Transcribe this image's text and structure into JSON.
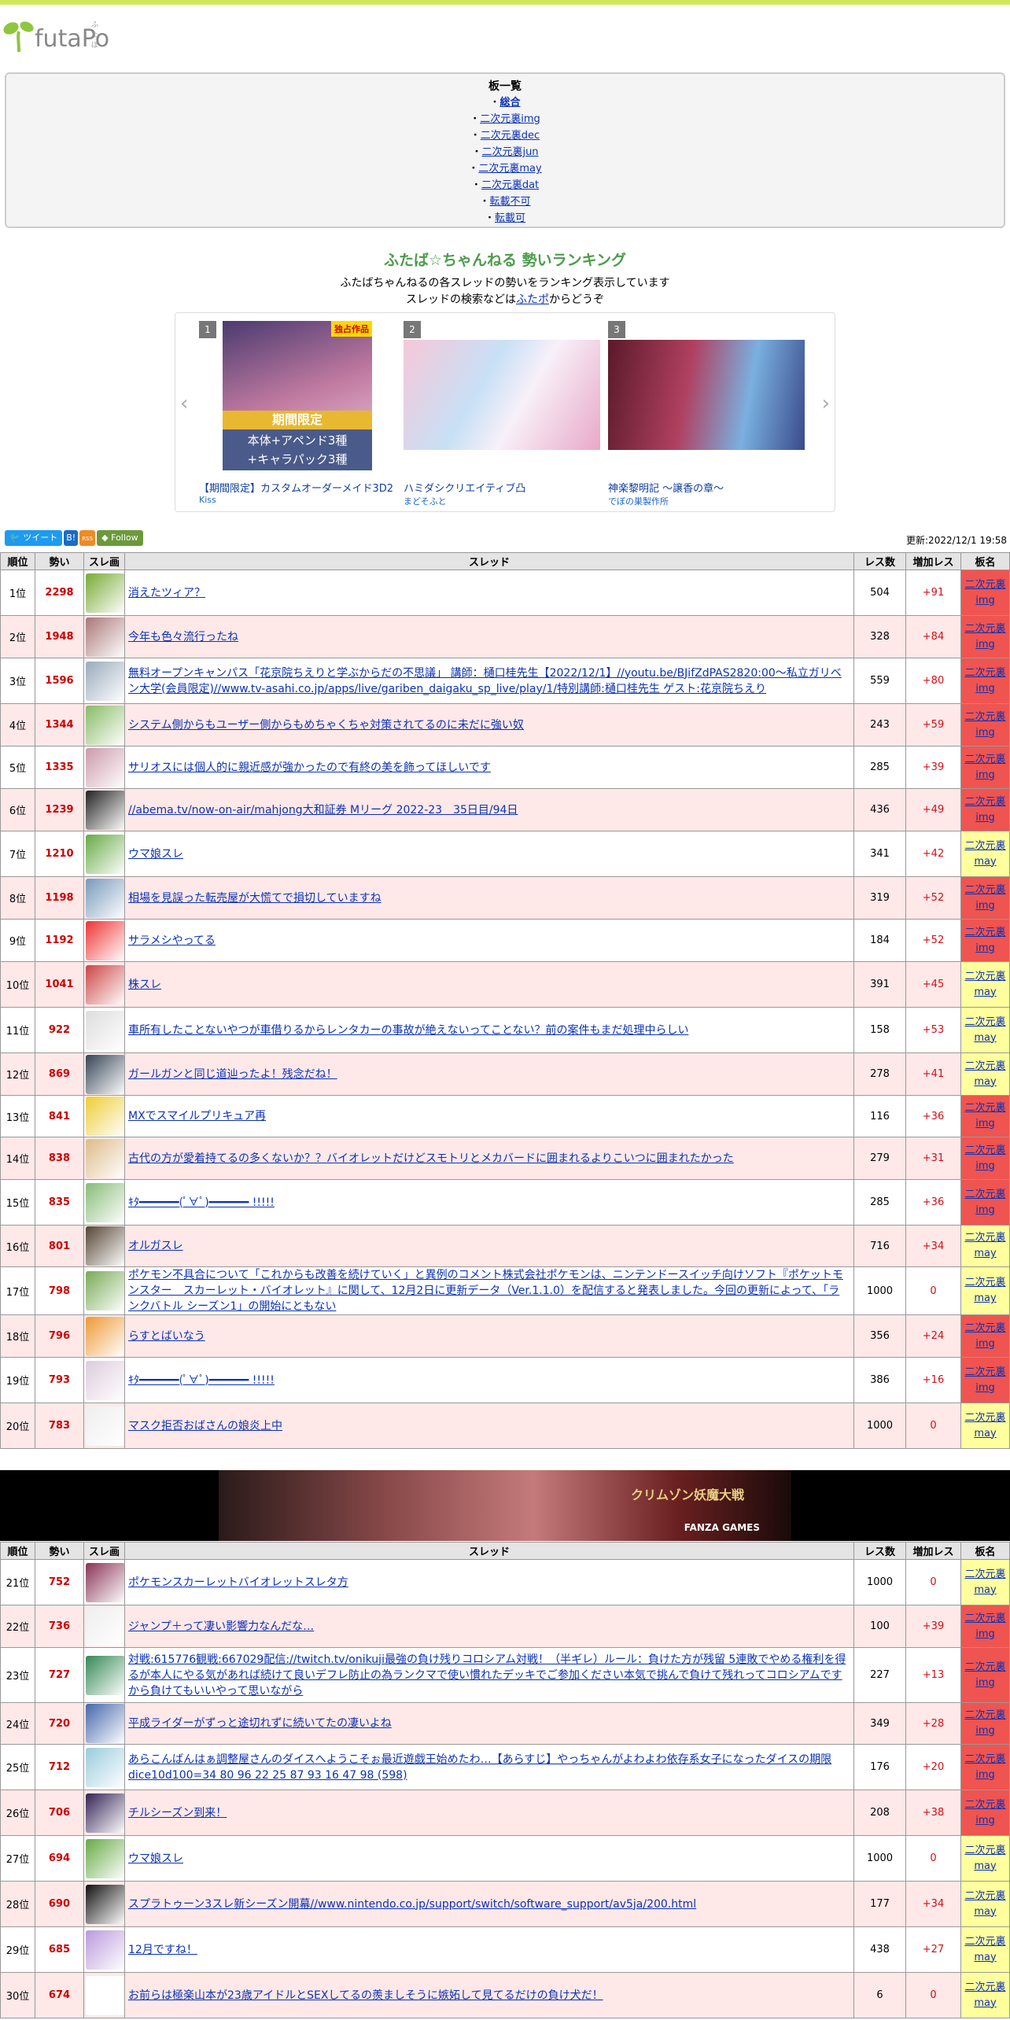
{
  "header": {
    "logo_text": "futaPo",
    "logo_sub": "ふたぽ"
  },
  "boards": {
    "title": "板一覧",
    "items": [
      {
        "label": "総合",
        "bold": true
      },
      {
        "label": "二次元裏img"
      },
      {
        "label": "二次元裏dec"
      },
      {
        "label": "二次元裏jun"
      },
      {
        "label": "二次元裏may"
      },
      {
        "label": "二次元裏dat"
      },
      {
        "label": "転載不可"
      },
      {
        "label": "転載可"
      }
    ]
  },
  "ranking": {
    "title": "ふたば☆ちゃんねる 勢いランキング",
    "desc1": "ふたばちゃんねるの各スレッドの勢いをランキング表示しています",
    "desc2_pre": "スレッドの検索などは",
    "desc2_link": "ふたポ",
    "desc2_post": "からどうぞ"
  },
  "carousel": {
    "prev": "‹",
    "next": "›",
    "cards": [
      {
        "num": "1",
        "title": "【期間限定】カスタムオーダーメイド3D2",
        "brand": "Kiss",
        "badge": "独占作品",
        "band1": "期間限定",
        "band2": "本体+アペンド3種",
        "band3": "+キャラパック3種"
      },
      {
        "num": "2",
        "title": "ハミダシクリエイティブ凸",
        "brand": "まどそふと"
      },
      {
        "num": "3",
        "title": "神楽黎明記 ～譲香の章～",
        "brand": "でぼの巣製作所"
      }
    ]
  },
  "social": {
    "tweet": "ツイート",
    "hatena": "B!",
    "rss": "RSS",
    "follow": "Follow"
  },
  "updated": "更新:2022/12/1 19:58",
  "table_headers": {
    "rank": "順位",
    "ikioi": "勢い",
    "thumb": "スレ画",
    "thread": "スレッド",
    "res": "レス数",
    "add": "増加レス",
    "board": "板名"
  },
  "rows1": [
    {
      "rank": "1位",
      "ikioi": "2298",
      "title": "消えたツィア？",
      "res": "504",
      "add": "+91",
      "board": "二次元裏img",
      "b": "img",
      "c": "#7a3"
    },
    {
      "rank": "2位",
      "ikioi": "1948",
      "title": "今年も色々流行ったね",
      "res": "328",
      "add": "+84",
      "board": "二次元裏img",
      "b": "img",
      "c": "#a77"
    },
    {
      "rank": "3位",
      "ikioi": "1596",
      "title": "無料オープンキャンパス「花京院ちえりと学ぶからだの不思議」 講師：樋口桂先生【2022/12/1】//youtu.be/BJifZdPAS2820:00～私立ガリベン大学(会員限定)//www.tv-asahi.co.jp/apps/live/gariben_daigaku_sp_live/play/1/特別講師:樋口桂先生 ゲスト:花京院ちえり",
      "res": "559",
      "add": "+80",
      "board": "二次元裏img",
      "b": "img",
      "c": "#9ab"
    },
    {
      "rank": "4位",
      "ikioi": "1344",
      "title": "システム側からもユーザー側からもめちゃくちゃ対策されてるのに未だに強い奴",
      "res": "243",
      "add": "+59",
      "board": "二次元裏img",
      "b": "img",
      "c": "#8b6"
    },
    {
      "rank": "5位",
      "ikioi": "1335",
      "title": "サリオスには個人的に親近感が強かったので有終の美を飾ってほしいです",
      "res": "285",
      "add": "+39",
      "board": "二次元裏img",
      "b": "img",
      "c": "#c9a"
    },
    {
      "rank": "6位",
      "ikioi": "1239",
      "title": "//abema.tv/now-on-air/mahjong大和証券 Mリーグ 2022-23　35日目/94日",
      "res": "436",
      "add": "+49",
      "board": "二次元裏img",
      "b": "img",
      "c": "#222"
    },
    {
      "rank": "7位",
      "ikioi": "1210",
      "title": "ウマ娘スレ",
      "res": "341",
      "add": "+42",
      "board": "二次元裏may",
      "b": "may",
      "c": "#6a4"
    },
    {
      "rank": "8位",
      "ikioi": "1198",
      "title": "相場を見誤った転売屋が大慌てで損切していますね",
      "res": "319",
      "add": "+52",
      "board": "二次元裏img",
      "b": "img",
      "c": "#79b"
    },
    {
      "rank": "9位",
      "ikioi": "1192",
      "title": "サラメシやってる",
      "res": "184",
      "add": "+52",
      "board": "二次元裏img",
      "b": "img",
      "c": "#e33"
    },
    {
      "rank": "10位",
      "ikioi": "1041",
      "title": "株スレ",
      "res": "391",
      "add": "+45",
      "board": "二次元裏may",
      "b": "may",
      "c": "#c44"
    },
    {
      "rank": "11位",
      "ikioi": "922",
      "title": "車所有したことないやつが車借りるからレンタカーの事故が絶えないってことない？前の案件もまだ処理中らしい",
      "res": "158",
      "add": "+53",
      "board": "二次元裏may",
      "b": "may",
      "c": "#ddd"
    },
    {
      "rank": "12位",
      "ikioi": "869",
      "title": "ガールガンと同じ道辿ったよ！残念だね！",
      "res": "278",
      "add": "+41",
      "board": "二次元裏may",
      "b": "may",
      "c": "#345"
    },
    {
      "rank": "13位",
      "ikioi": "841",
      "title": "MXでスマイルプリキュア再",
      "res": "116",
      "add": "+36",
      "board": "二次元裏img",
      "b": "img",
      "c": "#ec3"
    },
    {
      "rank": "14位",
      "ikioi": "838",
      "title": "古代の方が愛着持てるの多くないか？？バイオレットだけどスモトリとメカバードに囲まれるよりこいつに囲まれたかった",
      "res": "279",
      "add": "+31",
      "board": "二次元裏img",
      "b": "img",
      "c": "#db8"
    },
    {
      "rank": "15位",
      "ikioi": "835",
      "title": "ｷﾀ━━━━━━(ﾟ∀ﾟ)━━━━━━ !!!!!",
      "res": "285",
      "add": "+36",
      "board": "二次元裏img",
      "b": "img",
      "c": "#8b7"
    },
    {
      "rank": "16位",
      "ikioi": "801",
      "title": "オルガスレ",
      "res": "716",
      "add": "+34",
      "board": "二次元裏may",
      "b": "may",
      "c": "#543"
    },
    {
      "rank": "17位",
      "ikioi": "798",
      "title": "ポケモン不具合について「これからも改善を続けていく」と異例のコメント株式会社ポケモンは、ニンテンドースイッチ向けソフト『ポケットモンスター　スカーレット・バイオレット』に関して、12月2日に更新データ（Ver.1.1.0）を配信すると発表しました。今回の更新によって、「ランクバトル シーズン1」の開始にともない",
      "res": "1000",
      "add": "0",
      "board": "二次元裏may",
      "b": "may",
      "c": "#7a5"
    },
    {
      "rank": "18位",
      "ikioi": "796",
      "title": "らすとばいなう",
      "res": "356",
      "add": "+24",
      "board": "二次元裏img",
      "b": "img",
      "c": "#e93"
    },
    {
      "rank": "19位",
      "ikioi": "793",
      "title": "ｷﾀ━━━━━━(ﾟ∀ﾟ)━━━━━━ !!!!!",
      "res": "386",
      "add": "+16",
      "board": "二次元裏img",
      "b": "img",
      "c": "#dcd"
    },
    {
      "rank": "20位",
      "ikioi": "783",
      "title": "マスク拒否おばさんの娘炎上中",
      "res": "1000",
      "add": "0",
      "board": "二次元裏may",
      "b": "may",
      "c": "#eee"
    }
  ],
  "banner": {
    "logo": "クリムゾン妖魔大戦",
    "brand": "FANZA GAMES"
  },
  "rows2": [
    {
      "rank": "21位",
      "ikioi": "752",
      "title": "ポケモンスカーレットバイオレットスレタ方",
      "res": "1000",
      "add": "0",
      "board": "二次元裏may",
      "b": "may",
      "c": "#835"
    },
    {
      "rank": "22位",
      "ikioi": "736",
      "title": "ジャンプ＋って凄い影響力なんだな…",
      "res": "100",
      "add": "+39",
      "board": "二次元裏img",
      "b": "img",
      "c": "#eee"
    },
    {
      "rank": "23位",
      "ikioi": "727",
      "title": "対戦:615776観戦:667029配信://twitch.tv/onikuji最強の負け残りコロシアム対戦！（半ギレ）ルール：負けた方が残留 5連敗でやめる権利を得るが本人にやる気があれば続けて良いデフレ防止の為ランクマで使い慣れたデッキでご参加ください本気で挑んで負けて残れってコロシアムですから負けてもいいやって思いながら",
      "res": "227",
      "add": "+13",
      "board": "二次元裏img",
      "b": "img",
      "c": "#385"
    },
    {
      "rank": "24位",
      "ikioi": "720",
      "title": "平成ライダーがずっと途切れずに続いてたの凄いよね",
      "res": "349",
      "add": "+28",
      "board": "二次元裏img",
      "b": "img",
      "c": "#46a"
    },
    {
      "rank": "25位",
      "ikioi": "712",
      "title": "あらこんばんはぁ調整屋さんのダイスへようこそぉ最近遊戯王始めたわ…【あらすじ】やっちゃんがよわよわ依存系女子になったダイスの期限dice10d100=34 80 96 22 25 87 93 16 47 98 (598)",
      "res": "176",
      "add": "+20",
      "board": "二次元裏img",
      "b": "img",
      "c": "#9cd"
    },
    {
      "rank": "26位",
      "ikioi": "706",
      "title": "チルシーズン到来！",
      "res": "208",
      "add": "+38",
      "board": "二次元裏img",
      "b": "img",
      "c": "#325"
    },
    {
      "rank": "27位",
      "ikioi": "694",
      "title": "ウマ娘スレ",
      "res": "1000",
      "add": "0",
      "board": "二次元裏may",
      "b": "may",
      "c": "#6a4"
    },
    {
      "rank": "28位",
      "ikioi": "690",
      "title": "スプラトゥーン3スレ新シーズン開幕//www.nintendo.co.jp/support/switch/software_support/av5ja/200.html",
      "res": "177",
      "add": "+34",
      "board": "二次元裏may",
      "b": "may",
      "c": "#111"
    },
    {
      "rank": "29位",
      "ikioi": "685",
      "title": "12月ですね！",
      "res": "438",
      "add": "+27",
      "board": "二次元裏may",
      "b": "may",
      "c": "#b9d"
    },
    {
      "rank": "30位",
      "ikioi": "674",
      "title": "お前らは極楽山本が23歳アイドルとSEXしてるの羨ましそうに嫉妬して見てるだけの負け犬だ！",
      "res": "6",
      "add": "0",
      "board": "二次元裏may",
      "b": "may",
      "c": "#fff"
    }
  ]
}
